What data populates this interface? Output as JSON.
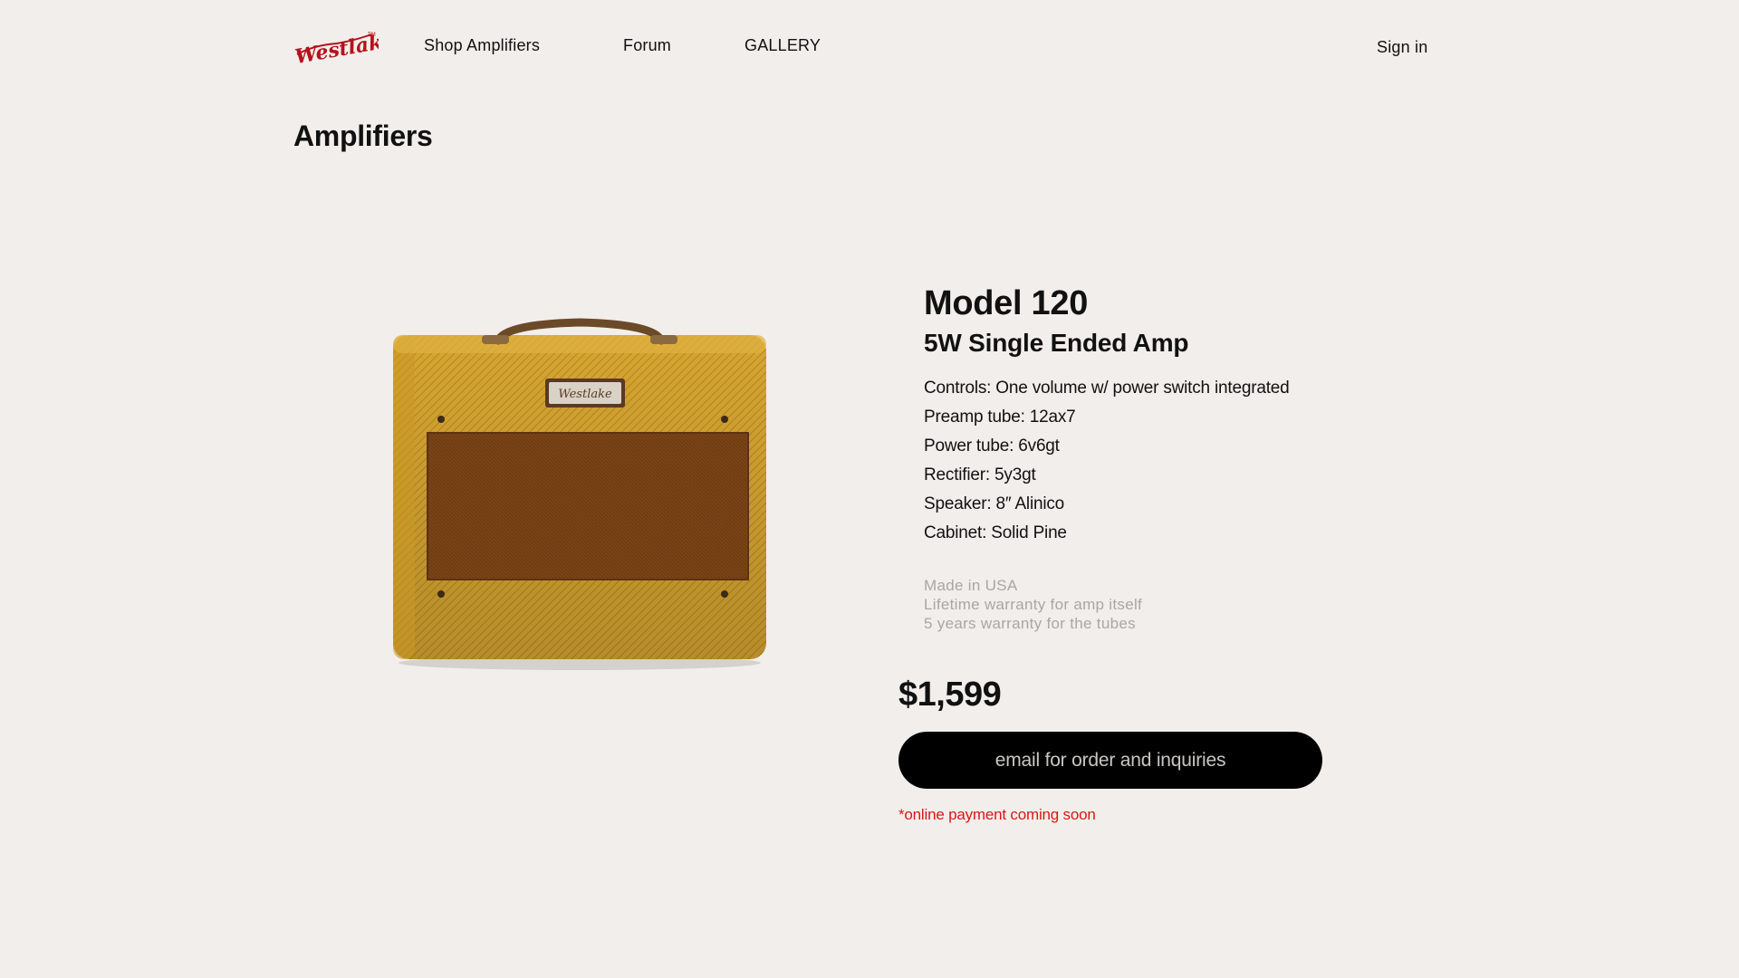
{
  "brand": {
    "logo_text": "Westlake"
  },
  "nav": {
    "shop": "Shop Amplifiers",
    "forum": "Forum",
    "gallery": "GALLERY",
    "signin": "Sign in"
  },
  "page_title": "Amplifiers",
  "product": {
    "name": "Model 120",
    "subtitle": "5W Single Ended Amp",
    "specs": [
      "Controls: One volume w/ power switch integrated",
      "Preamp tube: 12ax7",
      "Power tube: 6v6gt",
      "Rectifier: 5y3gt",
      "Speaker: 8″ Alinico",
      "Cabinet: Solid Pine"
    ],
    "notes": [
      "Made in USA",
      "Lifetime warranty for amp itself",
      "5 years warranty for the tubes"
    ],
    "price": "$1,599",
    "cta_label": "email for order and inquiries",
    "payment_note": "*online payment coming soon"
  },
  "colors": {
    "background": "#f2eeeb",
    "accent_red": "#d81818",
    "button_bg": "#000000",
    "tolex_yellow": "#d8a934",
    "grille_brown": "#7a4316"
  }
}
